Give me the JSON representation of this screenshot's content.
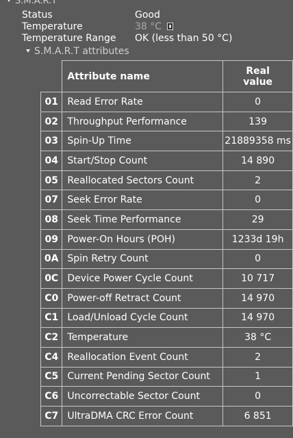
{
  "section": {
    "title": "S.M.A.R.T"
  },
  "status": {
    "label": "Status",
    "value": "Good"
  },
  "temperature": {
    "label": "Temperature",
    "value": "38 °C",
    "icon": "thermometer-icon"
  },
  "temperature_range": {
    "label": "Temperature Range",
    "value": "OK (less than 50 °C)"
  },
  "attributes_section": {
    "title": "S.M.A.R.T attributes"
  },
  "table": {
    "headers": {
      "name": "Attribute name",
      "value_line1": "Real",
      "value_line2": "value"
    },
    "rows": [
      {
        "id": "01",
        "name": "Read Error Rate",
        "value": "0"
      },
      {
        "id": "02",
        "name": "Throughput Performance",
        "value": "139"
      },
      {
        "id": "03",
        "name": "Spin-Up Time",
        "value": "21889358 ms"
      },
      {
        "id": "04",
        "name": "Start/Stop Count",
        "value": "14 890"
      },
      {
        "id": "05",
        "name": "Reallocated Sectors Count",
        "value": "2"
      },
      {
        "id": "07",
        "name": "Seek Error Rate",
        "value": "0"
      },
      {
        "id": "08",
        "name": "Seek Time Performance",
        "value": "29"
      },
      {
        "id": "09",
        "name": "Power-On Hours (POH)",
        "value": "1233d 19h"
      },
      {
        "id": "0A",
        "name": "Spin Retry Count",
        "value": "0"
      },
      {
        "id": "0C",
        "name": "Device Power Cycle Count",
        "value": "10 717"
      },
      {
        "id": "C0",
        "name": "Power-off Retract Count",
        "value": "14 970"
      },
      {
        "id": "C1",
        "name": "Load/Unload Cycle Count",
        "value": "14 970"
      },
      {
        "id": "C2",
        "name": "Temperature",
        "value": "38 °C"
      },
      {
        "id": "C4",
        "name": "Reallocation Event Count",
        "value": "2"
      },
      {
        "id": "C5",
        "name": "Current Pending Sector Count",
        "value": "1"
      },
      {
        "id": "C6",
        "name": "Uncorrectable Sector Count",
        "value": "0"
      },
      {
        "id": "C7",
        "name": "UltraDMA CRC Error Count",
        "value": "6 851"
      }
    ]
  }
}
